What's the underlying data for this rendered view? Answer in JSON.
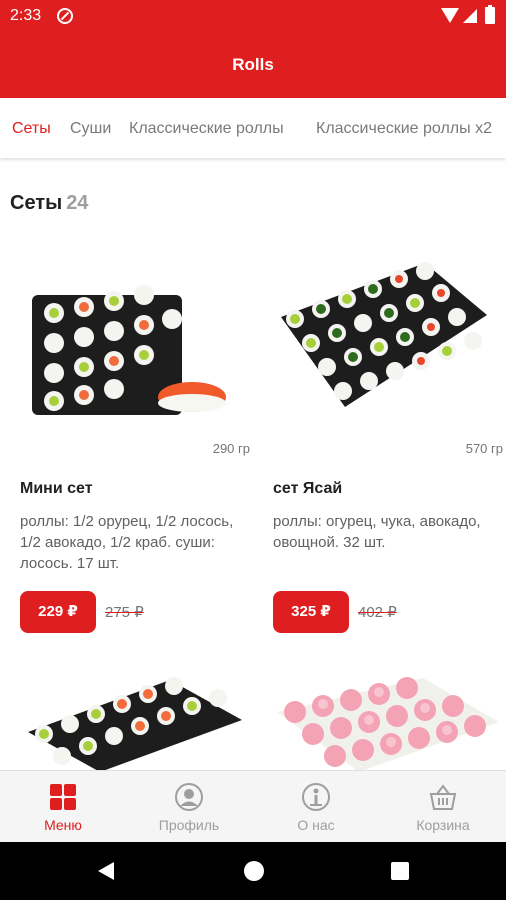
{
  "status_bar": {
    "time": "2:33"
  },
  "app_bar": {
    "title": "Rolls"
  },
  "tabs": [
    {
      "label": "Сеты",
      "active": true
    },
    {
      "label": "Суши",
      "active": false
    },
    {
      "label": "Классические роллы",
      "active": false
    },
    {
      "label": "Классические роллы x2",
      "active": false
    }
  ],
  "section": {
    "title": "Сеты",
    "count": "24"
  },
  "products": [
    {
      "image": "sushi-set-mini",
      "weight": "290 гр",
      "name": "Мини сет",
      "description": "роллы: 1/2 орурец, 1/2 лосось, 1/2 авокадо, 1/2 краб. суши: лосось. 17 шт.",
      "price": "229 ₽",
      "old_price": "275 ₽"
    },
    {
      "image": "sushi-set-yasai",
      "weight": "570 гр",
      "name": "сет Ясай",
      "description": "роллы: огурец, чука, авокадо, овощной. 32 шт.",
      "price": "325 ₽",
      "old_price": "402 ₽"
    },
    {
      "image": "sushi-set-mixed"
    },
    {
      "image": "sushi-set-pink"
    }
  ],
  "bottom_nav": [
    {
      "label": "Меню",
      "icon": "menu-grid-icon",
      "active": true
    },
    {
      "label": "Профиль",
      "icon": "profile-icon",
      "active": false
    },
    {
      "label": "О нас",
      "icon": "about-icon",
      "active": false
    },
    {
      "label": "Корзина",
      "icon": "basket-icon",
      "active": false
    }
  ],
  "colors": {
    "accent": "#df1f1f",
    "inactive": "#9e9e9e",
    "nav_bg": "#f5f5f5"
  }
}
